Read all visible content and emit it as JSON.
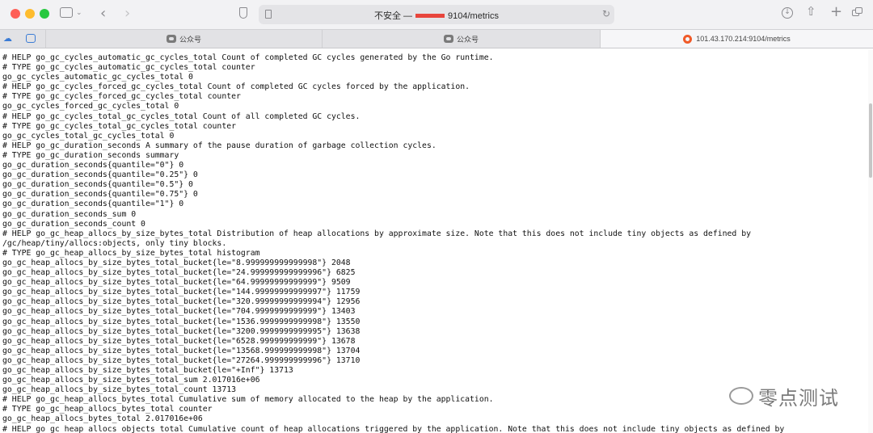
{
  "browser": {
    "url_prefix": "不安全 —",
    "url_suffix": "9104/metrics",
    "tabs": [
      {
        "label": "公众号",
        "icon": "wechat-icon"
      },
      {
        "label": "公众号",
        "icon": "wechat-icon"
      },
      {
        "label": "101.43.170.214:9104/metrics",
        "icon": "grafana-icon"
      }
    ]
  },
  "metrics_lines": [
    "# HELP go_gc_cycles_automatic_gc_cycles_total Count of completed GC cycles generated by the Go runtime.",
    "# TYPE go_gc_cycles_automatic_gc_cycles_total counter",
    "go_gc_cycles_automatic_gc_cycles_total 0",
    "# HELP go_gc_cycles_forced_gc_cycles_total Count of completed GC cycles forced by the application.",
    "# TYPE go_gc_cycles_forced_gc_cycles_total counter",
    "go_gc_cycles_forced_gc_cycles_total 0",
    "# HELP go_gc_cycles_total_gc_cycles_total Count of all completed GC cycles.",
    "# TYPE go_gc_cycles_total_gc_cycles_total counter",
    "go_gc_cycles_total_gc_cycles_total 0",
    "# HELP go_gc_duration_seconds A summary of the pause duration of garbage collection cycles.",
    "# TYPE go_gc_duration_seconds summary",
    "go_gc_duration_seconds{quantile=\"0\"} 0",
    "go_gc_duration_seconds{quantile=\"0.25\"} 0",
    "go_gc_duration_seconds{quantile=\"0.5\"} 0",
    "go_gc_duration_seconds{quantile=\"0.75\"} 0",
    "go_gc_duration_seconds{quantile=\"1\"} 0",
    "go_gc_duration_seconds_sum 0",
    "go_gc_duration_seconds_count 0",
    "# HELP go_gc_heap_allocs_by_size_bytes_total Distribution of heap allocations by approximate size. Note that this does not include tiny objects as defined by",
    "/gc/heap/tiny/allocs:objects, only tiny blocks.",
    "# TYPE go_gc_heap_allocs_by_size_bytes_total histogram",
    "go_gc_heap_allocs_by_size_bytes_total_bucket{le=\"8.999999999999998\"} 2048",
    "go_gc_heap_allocs_by_size_bytes_total_bucket{le=\"24.999999999999996\"} 6825",
    "go_gc_heap_allocs_by_size_bytes_total_bucket{le=\"64.99999999999999\"} 9509",
    "go_gc_heap_allocs_by_size_bytes_total_bucket{le=\"144.99999999999997\"} 11759",
    "go_gc_heap_allocs_by_size_bytes_total_bucket{le=\"320.99999999999994\"} 12956",
    "go_gc_heap_allocs_by_size_bytes_total_bucket{le=\"704.9999999999999\"} 13403",
    "go_gc_heap_allocs_by_size_bytes_total_bucket{le=\"1536.9999999999998\"} 13550",
    "go_gc_heap_allocs_by_size_bytes_total_bucket{le=\"3200.9999999999995\"} 13638",
    "go_gc_heap_allocs_by_size_bytes_total_bucket{le=\"6528.999999999999\"} 13678",
    "go_gc_heap_allocs_by_size_bytes_total_bucket{le=\"13568.999999999998\"} 13704",
    "go_gc_heap_allocs_by_size_bytes_total_bucket{le=\"27264.999999999996\"} 13710",
    "go_gc_heap_allocs_by_size_bytes_total_bucket{le=\"+Inf\"} 13713",
    "go_gc_heap_allocs_by_size_bytes_total_sum 2.017016e+06",
    "go_gc_heap_allocs_by_size_bytes_total_count 13713",
    "# HELP go_gc_heap_allocs_bytes_total Cumulative sum of memory allocated to the heap by the application.",
    "# TYPE go_gc_heap_allocs_bytes_total counter",
    "go_gc_heap_allocs_bytes_total 2.017016e+06",
    "# HELP go_gc_heap_allocs_objects_total Cumulative count of heap allocations triggered by the application. Note that this does not include tiny objects as defined by"
  ],
  "watermark": {
    "text": "零点测试"
  }
}
